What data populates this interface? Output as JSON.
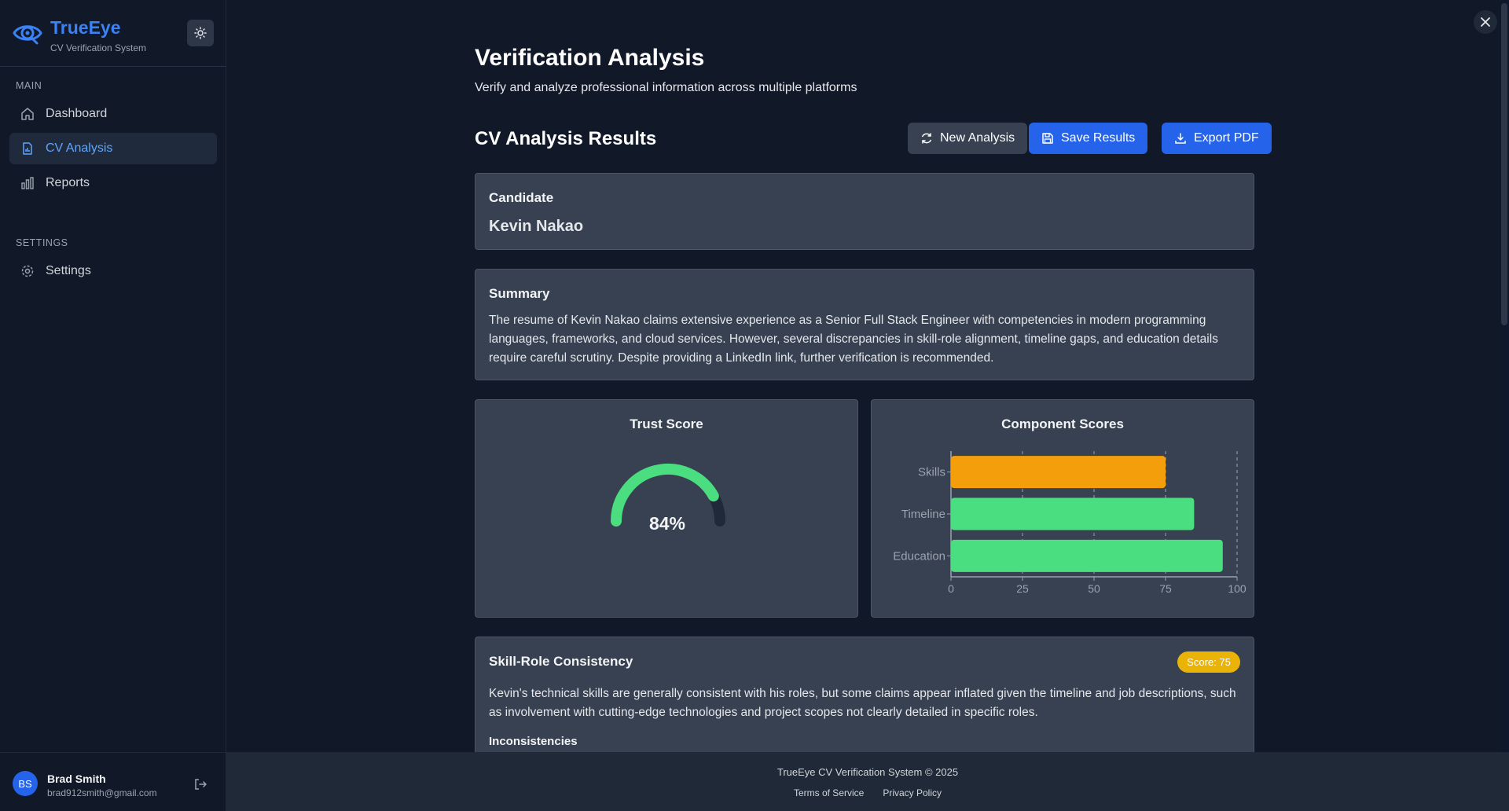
{
  "app": {
    "name": "TrueEye",
    "subtitle": "CV Verification System"
  },
  "sidebar": {
    "sections": [
      {
        "label": "MAIN",
        "items": [
          {
            "label": "Dashboard",
            "icon": "home-icon"
          },
          {
            "label": "CV Analysis",
            "icon": "document-chart-icon",
            "active": true
          },
          {
            "label": "Reports",
            "icon": "bar-chart-icon"
          }
        ]
      },
      {
        "label": "SETTINGS",
        "items": [
          {
            "label": "Settings",
            "icon": "gear-icon"
          }
        ]
      }
    ]
  },
  "user": {
    "initials": "BS",
    "name": "Brad Smith",
    "email": "brad912smith@gmail.com"
  },
  "page": {
    "title": "Verification Analysis",
    "subtitle": "Verify and analyze professional information across multiple platforms"
  },
  "results": {
    "title": "CV Analysis Results",
    "buttons": {
      "new": "New Analysis",
      "save": "Save Results",
      "export": "Export PDF"
    }
  },
  "candidate": {
    "label": "Candidate",
    "name": "Kevin Nakao"
  },
  "summary": {
    "label": "Summary",
    "text": "The resume of Kevin Nakao claims extensive experience as a Senior Full Stack Engineer with competencies in modern programming languages, frameworks, and cloud services. However, several discrepancies in skill-role alignment, timeline gaps, and education details require careful scrutiny. Despite providing a LinkedIn link, further verification is recommended."
  },
  "trust": {
    "title": "Trust Score",
    "value": 84,
    "display": "84%"
  },
  "components": {
    "title": "Component Scores"
  },
  "chart_data": {
    "type": "bar",
    "orientation": "horizontal",
    "title": "Component Scores",
    "categories": [
      "Skills",
      "Timeline",
      "Education"
    ],
    "values": [
      75,
      85,
      95
    ],
    "colors": [
      "#f59e0b",
      "#4ade80",
      "#4ade80"
    ],
    "xlim": [
      0,
      100
    ],
    "xticks": [
      0,
      25,
      50,
      75,
      100
    ],
    "grid": true
  },
  "skill_role": {
    "title": "Skill-Role Consistency",
    "badge": "Score: 75",
    "text": "Kevin's technical skills are generally consistent with his roles, but some claims appear inflated given the timeline and job descriptions, such as involvement with cutting-edge technologies and project scopes not clearly detailed in specific roles.",
    "subheading": "Inconsistencies"
  },
  "footer": {
    "copyright": "TrueEye CV Verification System © 2025",
    "links": [
      "Terms of Service",
      "Privacy Policy"
    ]
  },
  "colors": {
    "accent": "#3b82f6",
    "good": "#4ade80",
    "warn": "#f59e0b",
    "badge": "#eab308"
  }
}
